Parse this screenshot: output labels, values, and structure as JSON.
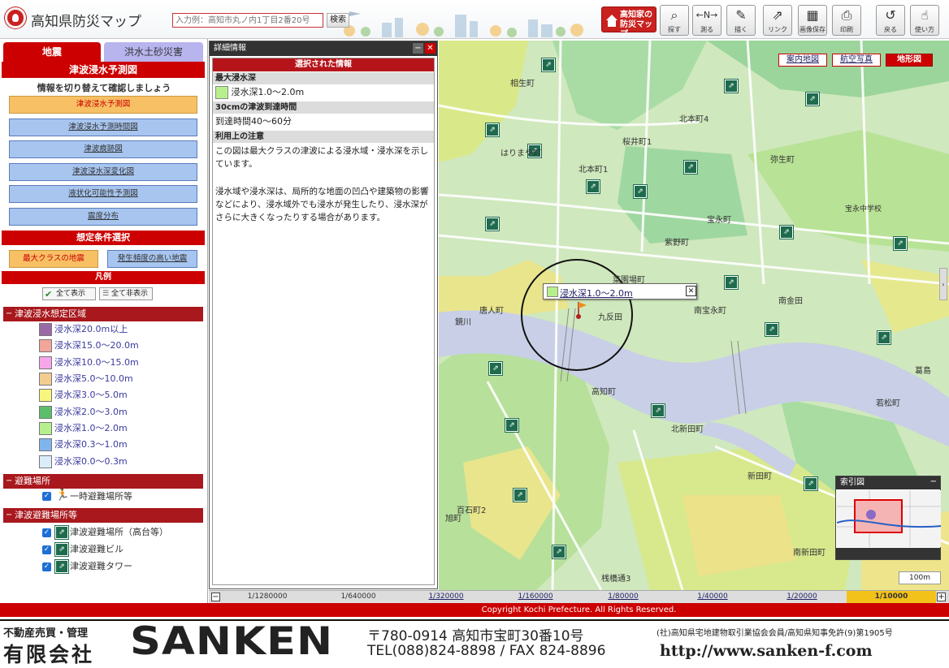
{
  "header": {
    "title": "高知県防災マップ",
    "search_placeholder": "入力例：高知市丸ノ内1丁目2番20号",
    "search_button": "検索",
    "home_button": "高知家の防災マップ",
    "tools": [
      {
        "label": "探す",
        "icon": "search-icon"
      },
      {
        "label": "測る",
        "icon": "measure-icon"
      },
      {
        "label": "描く",
        "icon": "draw-icon"
      },
      {
        "label": "リンク",
        "icon": "link-icon"
      },
      {
        "label": "画像保存",
        "icon": "image-save-icon"
      },
      {
        "label": "印刷",
        "icon": "print-icon"
      },
      {
        "label": "戻る",
        "icon": "back-icon"
      },
      {
        "label": "使い方",
        "icon": "help-icon"
      }
    ]
  },
  "sidebar": {
    "tabs": [
      {
        "label": "地震"
      },
      {
        "label": "洪水土砂災害"
      }
    ],
    "section_title": "津波浸水予測図",
    "instruction": "情報を切り替えて確認しましょう",
    "menu_items": [
      {
        "label": "津波浸水予測図",
        "selected": true
      },
      {
        "label": "津波浸水予測時間図",
        "selected": false
      },
      {
        "label": "津波痕跡図",
        "selected": false
      },
      {
        "label": "津波浸水深変化図",
        "selected": false
      },
      {
        "label": "液状化可能性予測図",
        "selected": false
      },
      {
        "label": "震度分布",
        "selected": false
      }
    ],
    "assumption_title": "想定条件選択",
    "assumptions": [
      {
        "label": "最大クラスの地震",
        "selected": true
      },
      {
        "label": "発生頻度の高い地震",
        "selected": false
      }
    ],
    "legend_title": "凡例",
    "show_all": "全て表示",
    "hide_all": "全て非表示",
    "legend_groups": [
      {
        "title": "津波浸水想定区域",
        "items": [
          {
            "label": "浸水深20.0m以上",
            "color": "#9a6aa6"
          },
          {
            "label": "浸水深15.0～20.0m",
            "color": "#f2a59a"
          },
          {
            "label": "浸水深10.0～15.0m",
            "color": "#f8a6ea"
          },
          {
            "label": "浸水深5.0～10.0m",
            "color": "#f3cc8f"
          },
          {
            "label": "浸水深3.0～5.0m",
            "color": "#f7f67d"
          },
          {
            "label": "浸水深2.0～3.0m",
            "color": "#5bbf6a"
          },
          {
            "label": "浸水深1.0～2.0m",
            "color": "#b6f08d"
          },
          {
            "label": "浸水深0.3～1.0m",
            "color": "#7fb5ee"
          },
          {
            "label": "浸水深0.0～0.3m",
            "color": "#d9ecf8"
          }
        ]
      },
      {
        "title": "避難場所",
        "items": [
          {
            "label": "一時避難場所等"
          }
        ]
      },
      {
        "title": "津波避難場所等",
        "items": [
          {
            "label": "津波避難場所（高台等）"
          },
          {
            "label": "津波避難ビル"
          },
          {
            "label": "津波避難タワー"
          }
        ]
      }
    ]
  },
  "detail": {
    "title": "詳細情報",
    "selected_header": "選択された情報",
    "depth_label": "最大浸水深",
    "depth_value": "浸水深1.0～2.0m",
    "depth_color": "#b6f08d",
    "arrival_label": "30cmの津波到達時間",
    "arrival_value": "到達時間40～60分",
    "notes_label": "利用上の注意",
    "note1": "この図は最大クラスの津波による浸水域・浸水深を示しています。",
    "note2": "浸水域や浸水深は、局所的な地面の凹凸や建築物の影響などにより、浸水域外でも浸水が発生したり、浸水深がさらに大きくなったりする場合があります。"
  },
  "map": {
    "layer_buttons": [
      {
        "label": "案内地図",
        "selected": false
      },
      {
        "label": "航空写真",
        "selected": false
      },
      {
        "label": "地形図",
        "selected": true
      }
    ],
    "popup_text": "浸水深1.0～2.0m",
    "river_name": "鏡川",
    "place_labels": [
      "相生町",
      "北本町4",
      "桜井町1",
      "弥生町",
      "宝永町",
      "北本町1",
      "紫野町",
      "菜園場町",
      "九反田",
      "唐人町",
      "南宝永町",
      "南金田",
      "葛島",
      "北新田町",
      "高知町",
      "百石町2",
      "新田町",
      "若松町",
      "南新田町",
      "桟橋通3",
      "はりまや町",
      "旭町",
      "宝永中学校"
    ],
    "overview_title": "索引図",
    "scale_indicator": "100m"
  },
  "scale_bar": {
    "scales": [
      {
        "label": "1/1280000",
        "link": false
      },
      {
        "label": "1/640000",
        "link": false
      },
      {
        "label": "1/320000",
        "link": true
      },
      {
        "label": "1/160000",
        "link": true
      },
      {
        "label": "1/80000",
        "link": true
      },
      {
        "label": "1/40000",
        "link": true
      },
      {
        "label": "1/20000",
        "link": true
      },
      {
        "label": "1/10000",
        "link": false,
        "selected": true
      }
    ]
  },
  "copyright": "Copyright Kochi Prefecture. All Rights Reserved.",
  "ad": {
    "tagline": "不動産売買・管理",
    "company": "有限会社",
    "brand": "SANKEN",
    "address": "〒780-0914 高知市宝町30番10号",
    "tel": "TEL(088)824-8898 / FAX 824-8896",
    "license": "(社)高知県宅地建物取引業協会会員/高知県知事免許(9)第1905号",
    "url": "http://www.sanken-f.com"
  }
}
